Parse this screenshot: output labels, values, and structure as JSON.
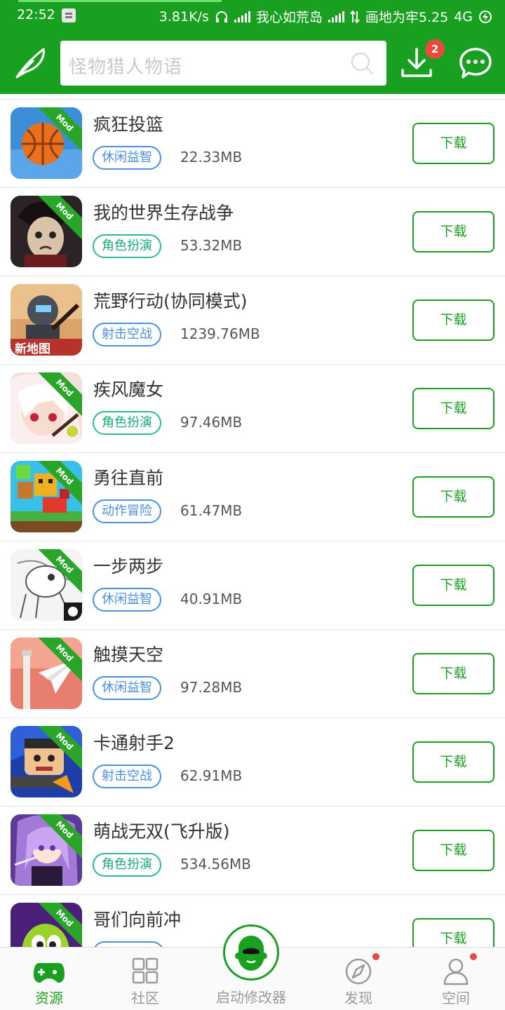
{
  "status_bar": {
    "time": "22:52",
    "speed": "3.81K/s",
    "carrier1": "我心如荒岛",
    "carrier2": "画地为牢5.25",
    "network": "4G"
  },
  "header": {
    "search_placeholder": "怪物猎人物语",
    "download_badge": "2"
  },
  "apps": [
    {
      "name": "疯狂投篮",
      "tag": "休闲益智",
      "tag_style": "blue",
      "size": "22.33MB",
      "button": "下载",
      "mod": true
    },
    {
      "name": "我的世界生存战争",
      "tag": "角色扮演",
      "tag_style": "teal",
      "size": "53.32MB",
      "button": "下载",
      "mod": true
    },
    {
      "name": "荒野行动(协同模式)",
      "tag": "射击空战",
      "tag_style": "blue",
      "size": "1239.76MB",
      "button": "下载",
      "mod": false,
      "icon_text": "新地图"
    },
    {
      "name": "疾风魔女",
      "tag": "角色扮演",
      "tag_style": "teal",
      "size": "97.46MB",
      "button": "下载",
      "mod": true
    },
    {
      "name": "勇往直前",
      "tag": "动作冒险",
      "tag_style": "blue",
      "size": "61.47MB",
      "button": "下载",
      "mod": true
    },
    {
      "name": "一步两步",
      "tag": "休闲益智",
      "tag_style": "blue",
      "size": "40.91MB",
      "button": "下载",
      "mod": true
    },
    {
      "name": "触摸天空",
      "tag": "休闲益智",
      "tag_style": "blue",
      "size": "97.28MB",
      "button": "下载",
      "mod": true
    },
    {
      "name": "卡通射手2",
      "tag": "射击空战",
      "tag_style": "blue",
      "size": "62.91MB",
      "button": "下载",
      "mod": true
    },
    {
      "name": "萌战无双(飞升版)",
      "tag": "角色扮演",
      "tag_style": "teal",
      "size": "534.56MB",
      "button": "下载",
      "mod": true
    },
    {
      "name": "哥们向前冲",
      "tag": "",
      "tag_style": "blue",
      "size": "",
      "button": "下载",
      "mod": true
    }
  ],
  "mod_label": "Mod",
  "bottom_nav": {
    "items": [
      {
        "label": "资源",
        "active": true
      },
      {
        "label": "社区",
        "active": false
      },
      {
        "label": "启动修改器",
        "active": false
      },
      {
        "label": "发现",
        "active": false
      },
      {
        "label": "空间",
        "active": false
      }
    ]
  },
  "colors": {
    "brand_green": "#1aa020",
    "badge_red": "#e84b3c",
    "tag_blue": "#4a90e2",
    "tag_teal": "#2cb89a"
  }
}
